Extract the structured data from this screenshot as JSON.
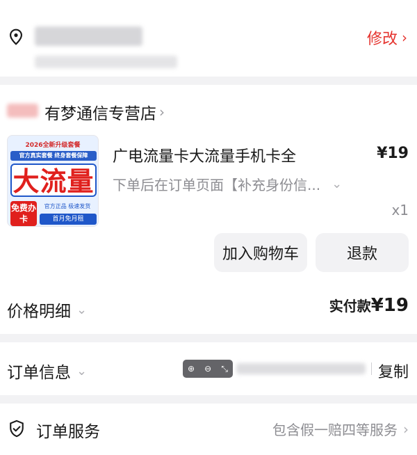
{
  "address": {
    "modify_label": "修改"
  },
  "order": {
    "shop_name": "有梦通信专营店",
    "product": {
      "title": "广电流量卡大流量手机卡全",
      "price": "¥19",
      "spec": "下单后在订单页面【补充身份信...",
      "quantity": "x1",
      "image": {
        "top_text": "2026全新升级套餐",
        "strip_text": "官方真实套餐  终身套餐保障",
        "main_text": "大流量",
        "free_text": "免费办卡",
        "small_text": "官方正品  极速发货",
        "bottom_text": "首月免月租"
      }
    },
    "buttons": {
      "add_to_cart": "加入购物车",
      "refund": "退款"
    },
    "price_detail_label": "价格明细",
    "paid_label": "实付款",
    "paid_amount": "¥19"
  },
  "order_info": {
    "label": "订单信息",
    "copy_label": "复制"
  },
  "order_service": {
    "label": "订单服务",
    "description": "包含假一赔四等服务"
  },
  "colors": {
    "accent_red": "#e5332e",
    "page_bg": "#f2f2f4",
    "muted_text": "#8d8d92"
  }
}
